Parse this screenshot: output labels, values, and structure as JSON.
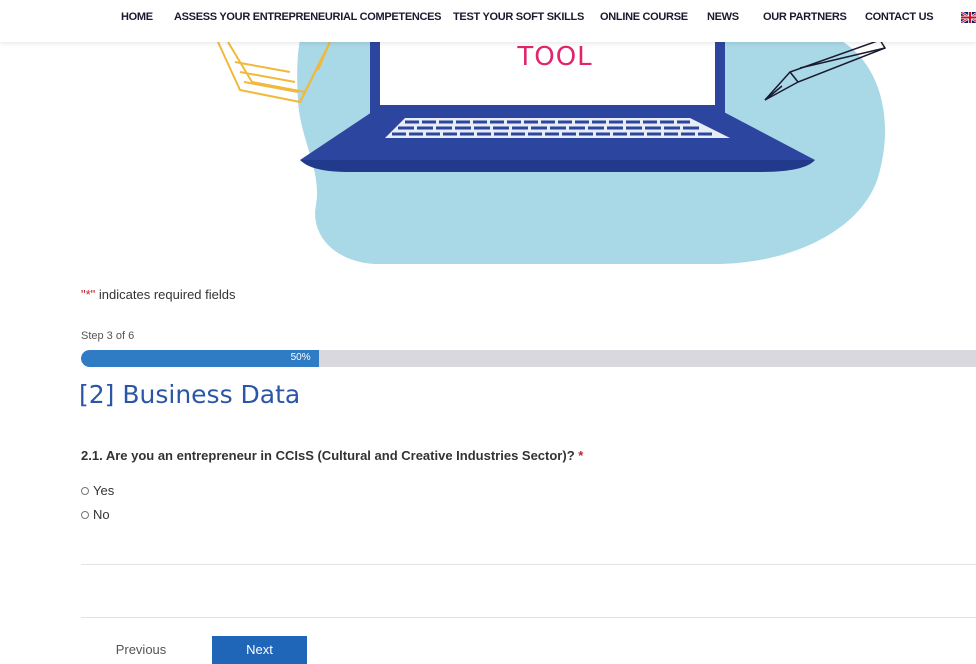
{
  "nav": {
    "items": [
      "HOME",
      "ASSESS YOUR ENTREPRENEURIAL COMPETENCES",
      "TEST YOUR SOFT SKILLS",
      "ONLINE COURSE",
      "NEWS",
      "OUR PARTNERS",
      "CONTACT US"
    ],
    "language_icon": "uk-flag-icon"
  },
  "hero": {
    "title": "TOOL"
  },
  "form": {
    "required_marker": "\"*\"",
    "required_note": " indicates required fields",
    "step_label": "Step 3 of 6",
    "progress": {
      "percent": 50,
      "label": "50%"
    },
    "section_title": "[2] Business Data",
    "question": {
      "text": "2.1. Are you an entrepreneur in CCIsS (Cultural and Creative Industries Sector)?",
      "required_marker": "*",
      "options": [
        "Yes",
        "No"
      ]
    },
    "buttons": {
      "previous": "Previous",
      "next": "Next"
    }
  },
  "colors": {
    "accent_blue": "#2f7bc4",
    "title_blue": "#2b56a8",
    "next_button": "#1f66b8",
    "hero_pink": "#e0246e",
    "required_red": "#c0262d",
    "hero_blob": "#a9d8e6",
    "laptop_blue": "#2c46a0"
  }
}
